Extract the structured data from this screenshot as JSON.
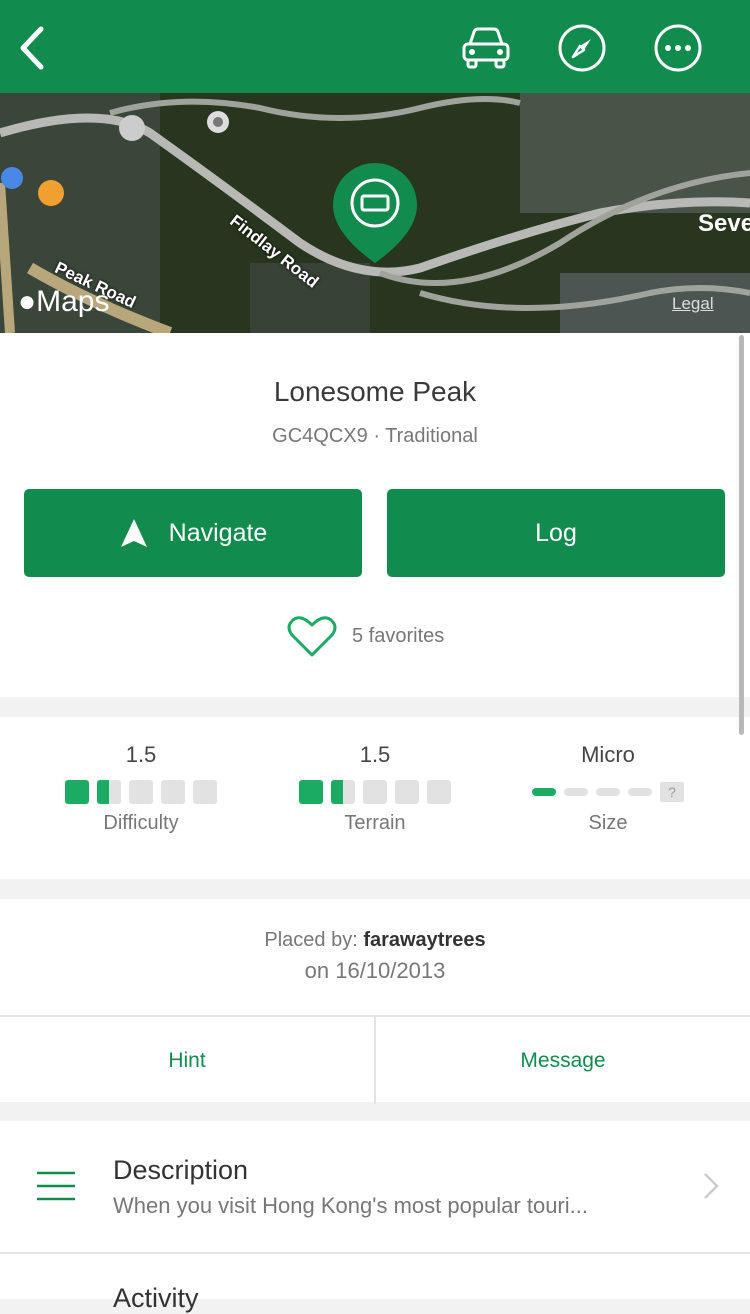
{
  "header": {
    "back_icon": "chevron-left-icon",
    "icons": [
      "car-icon",
      "compass-icon",
      "more-icon"
    ],
    "accent_color": "#118b4e"
  },
  "map": {
    "road_1": "Findlay Road",
    "road_2": "Peak Road",
    "place_partial": "Seve",
    "logo": "Maps",
    "legal": "Legal"
  },
  "cache": {
    "name": "Lonesome Peak",
    "code_type": "GC4QCX9 · Traditional",
    "navigate_label": "Navigate",
    "log_label": "Log",
    "favorites": "5 favorites"
  },
  "ratings": {
    "difficulty": {
      "value": "1.5",
      "label": "Difficulty",
      "level": 1.5,
      "max": 5
    },
    "terrain": {
      "value": "1.5",
      "label": "Terrain",
      "level": 1.5,
      "max": 5
    },
    "size": {
      "value": "Micro",
      "label": "Size",
      "level": 1
    }
  },
  "placed": {
    "prefix": "Placed by:",
    "by": "farawaytrees",
    "on": "on 16/10/2013"
  },
  "actions": {
    "hint": "Hint",
    "message": "Message"
  },
  "description": {
    "title": "Description",
    "text": "When you visit Hong Kong's most popular touri..."
  },
  "next_section": "Activity"
}
